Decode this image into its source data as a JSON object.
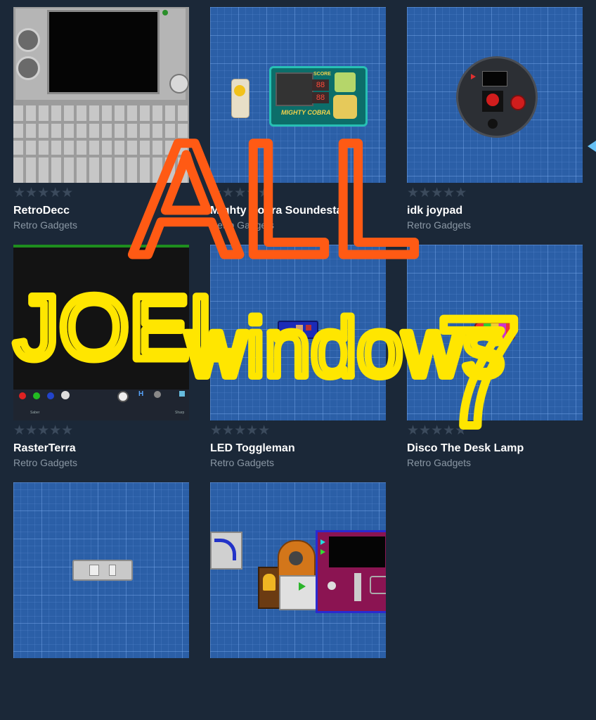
{
  "items": [
    {
      "title": "RetroDecc",
      "subtitle": "Retro Gadgets"
    },
    {
      "title": "Mighty Cobra Soundesta",
      "subtitle": "Retro Gadgets"
    },
    {
      "title": "idk joypad",
      "subtitle": "Retro Gadgets"
    },
    {
      "title": "RasterTerra",
      "subtitle": "Retro Gadgets"
    },
    {
      "title": "LED Toggleman",
      "subtitle": "Retro Gadgets"
    },
    {
      "title": "Disco The Desk Lamp",
      "subtitle": "Retro Gadgets"
    },
    {
      "title": "",
      "subtitle": ""
    },
    {
      "title": "",
      "subtitle": ""
    }
  ],
  "stars": "★★★★★",
  "thumb_text": {
    "cobra_score": "SCORE",
    "cobra_digits_1": "88",
    "cobra_digits_2": "88",
    "cobra_name": "MIGHTY COBRA",
    "raster_label_1": "Saber",
    "raster_label_2": "Sharp",
    "raster_letter": "H"
  },
  "annotations": {
    "all": "ALL",
    "joel": "JOEL",
    "windows": "windows",
    "seven": "7"
  },
  "colors": {
    "background": "#1b2838",
    "title": "#ffffff",
    "subtitle": "#8a97a4",
    "star_inactive": "#3b4a5c",
    "annotation_orange": "#ff5a14",
    "annotation_yellow": "#ffe600",
    "accent": "#66c0f4"
  }
}
